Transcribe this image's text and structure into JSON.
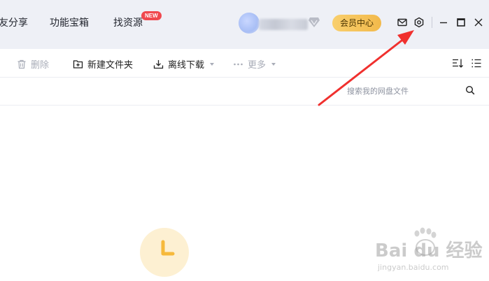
{
  "nav": {
    "items": [
      {
        "label": "友分享"
      },
      {
        "label": "功能宝箱"
      },
      {
        "label": "找资源"
      }
    ],
    "new_badge": "NEW"
  },
  "header": {
    "vip_label": "会员中心",
    "icons": [
      "mail-icon",
      "settings-icon",
      "minimize-icon",
      "maximize-icon",
      "close-icon"
    ]
  },
  "toolbar": {
    "delete_label": "删除",
    "new_folder_label": "新建文件夹",
    "offline_download_label": "离线下载",
    "more_label": "更多"
  },
  "search": {
    "placeholder": "搜索我的网盘文件"
  },
  "watermark": {
    "logo_text": "Bai du 经验",
    "url_text": "jingyan.baidu.com"
  },
  "colors": {
    "topbar_bg": "#eef0f6",
    "vip_gold": "#f5c35a",
    "badge_red": "#f0484e",
    "annotation_red": "#f0302e",
    "loader_bg": "#fdf0d2",
    "loader_icon": "#f6b93b"
  }
}
